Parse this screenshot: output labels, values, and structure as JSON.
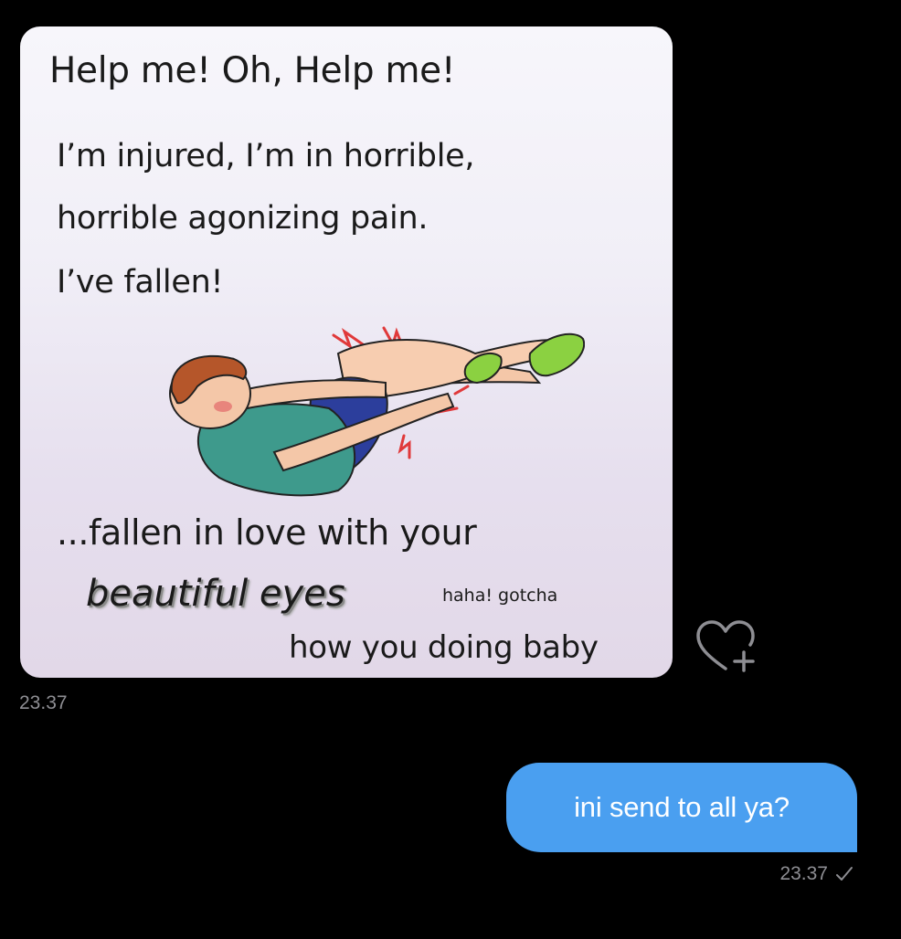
{
  "received_message": {
    "meme": {
      "title": "Help me! Oh, Help me!",
      "line1": "I’m injured, I’m in horrible,",
      "line2": "horrible agonizing pain.",
      "line3": "I’ve fallen!",
      "line4": "...fallen in love with your",
      "line5": "beautiful eyes",
      "gotcha": "haha! gotcha",
      "line6": "how you doing baby"
    },
    "timestamp": "23.37",
    "react_icon": "heart-plus-icon"
  },
  "sent_message": {
    "text": "ini send to all ya?",
    "timestamp": "23.37",
    "status_icon": "check-icon"
  },
  "colors": {
    "background": "#000000",
    "sent_bubble": "#4a9ff0",
    "timestamp": "#8e8e93"
  }
}
